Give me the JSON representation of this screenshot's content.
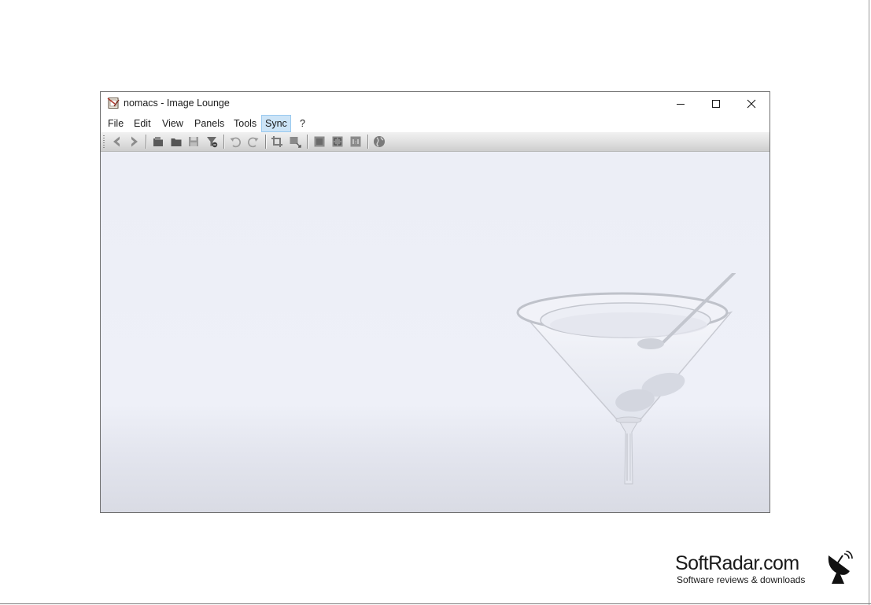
{
  "window": {
    "title": "nomacs - Image Lounge",
    "icon": "nomacs-app-icon",
    "controls": [
      "minimize-icon",
      "maximize-icon",
      "close-icon"
    ]
  },
  "menu": {
    "items": [
      {
        "label": "File"
      },
      {
        "label": "Edit"
      },
      {
        "label": "View"
      },
      {
        "label": "Panels"
      },
      {
        "label": "Tools"
      },
      {
        "label": "Sync",
        "active": true
      },
      {
        "label": "?"
      }
    ]
  },
  "toolbar": {
    "buttons": [
      "previous-icon",
      "next-icon",
      "open-file-icon",
      "open-folder-icon",
      "save-icon",
      "filter-icon",
      "rotate-left-icon",
      "rotate-right-icon",
      "crop-icon",
      "resize-icon",
      "fullscreen-icon",
      "fit-window-icon",
      "actual-size-icon",
      "web-icon"
    ]
  },
  "branding": {
    "name": "SoftRadar.com",
    "tagline": "Software reviews & downloads",
    "icon": "satellite-dish-icon"
  },
  "colors": {
    "menu_active_bg": "#cce4f7",
    "menu_active_border": "#99c9ef",
    "viewport_bg": "#eceef6"
  }
}
